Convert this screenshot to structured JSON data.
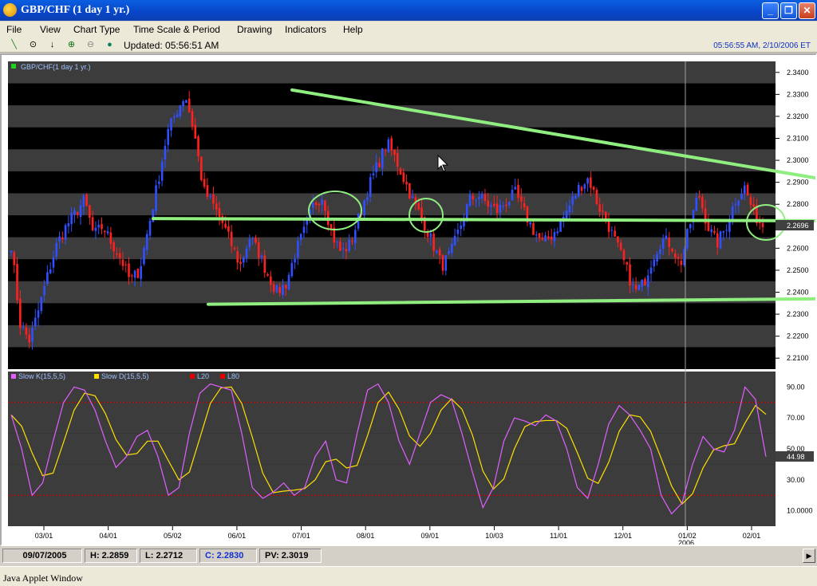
{
  "window": {
    "title": "GBP/CHF (1 day 1 yr.)"
  },
  "menu": [
    "File",
    "View",
    "Chart Type",
    "Time Scale & Period",
    "Drawing",
    "Indicators",
    "Help"
  ],
  "toolbar": {
    "updated": "Updated: 05:56:51 AM",
    "clock": "05:56:55 AM, 2/10/2006 ET"
  },
  "price_panel": {
    "legend": "GBP/CHF(1 day 1 yr.)",
    "legend_color": "#20d020",
    "y_ticks": [
      "2.3400",
      "2.3300",
      "2.3200",
      "2.3100",
      "2.3000",
      "2.2900",
      "2.2800",
      "2.2700",
      "2.2600",
      "2.2500",
      "2.2400",
      "2.2300",
      "2.2200",
      "2.2100"
    ],
    "last_price": "2.2696",
    "up_color": "#3050ff",
    "down_color": "#ff2020",
    "trendline_color": "#90ee80"
  },
  "stoch_panel": {
    "legend": [
      {
        "label": "Slow K(15,5,5)",
        "color": "#e060ff"
      },
      {
        "label": "Slow D(15,5,5)",
        "color": "#ffe000"
      },
      {
        "label": "L20",
        "color": "#e00000"
      },
      {
        "label": "L80",
        "color": "#e00000"
      }
    ],
    "y_ticks": [
      "90.00",
      "70.00",
      "50.00",
      "30.00",
      "10.0000"
    ],
    "last_value": "44.98"
  },
  "x_axis": {
    "labels": [
      "03/01",
      "04/01",
      "05/02",
      "06/01",
      "07/01",
      "08/01",
      "09/01",
      "10/03",
      "11/01",
      "12/01",
      "01/02",
      "02/01"
    ],
    "year_label": "2006"
  },
  "status": {
    "date": "09/07/2005",
    "high": "H: 2.2859",
    "low": "L: 2.2712",
    "close": "C: 2.2830",
    "pv": "PV: 2.3019"
  },
  "footer": "Java Applet Window",
  "chart_data": {
    "type": "candlestick",
    "title": "GBP/CHF (1 day 1 yr.)",
    "ylim": [
      2.205,
      2.345
    ],
    "x_labels": [
      "03/01",
      "04/01",
      "05/02",
      "06/01",
      "07/01",
      "08/01",
      "09/01",
      "10/03",
      "11/01",
      "12/01",
      "01/02",
      "02/01"
    ],
    "close_anchors": [
      2.262,
      2.225,
      2.218,
      2.232,
      2.248,
      2.262,
      2.27,
      2.276,
      2.282,
      2.266,
      2.27,
      2.262,
      2.255,
      2.245,
      2.25,
      2.27,
      2.29,
      2.312,
      2.322,
      2.33,
      2.312,
      2.286,
      2.28,
      2.272,
      2.262,
      2.252,
      2.265,
      2.258,
      2.248,
      2.24,
      2.244,
      2.258,
      2.268,
      2.28,
      2.284,
      2.266,
      2.258,
      2.262,
      2.275,
      2.288,
      2.298,
      2.308,
      2.3,
      2.29,
      2.28,
      2.272,
      2.262,
      2.252,
      2.258,
      2.27,
      2.282,
      2.284,
      2.28,
      2.277,
      2.281,
      2.285,
      2.276,
      2.268,
      2.262,
      2.266,
      2.272,
      2.28,
      2.288,
      2.292,
      2.28,
      2.272,
      2.262,
      2.252,
      2.24,
      2.244,
      2.256,
      2.264,
      2.262,
      2.252,
      2.27,
      2.285,
      2.27,
      2.262,
      2.27,
      2.282,
      2.288,
      2.276,
      2.27
    ],
    "last_close": 2.2696,
    "trendlines_price": [
      {
        "from": [
          "06/23",
          2.332
        ],
        "to": [
          "02/10",
          2.292
        ]
      },
      {
        "from": [
          "04/15",
          2.2735
        ],
        "to": [
          "02/10",
          2.2725
        ]
      },
      {
        "from": [
          "05/16",
          2.2345
        ],
        "to": [
          "02/10",
          2.237
        ]
      }
    ],
    "stochastic": {
      "slow_k_anchors": [
        72,
        50,
        20,
        28,
        55,
        80,
        90,
        88,
        75,
        55,
        38,
        45,
        58,
        62,
        45,
        20,
        25,
        60,
        86,
        92,
        90,
        88,
        60,
        25,
        18,
        22,
        28,
        20,
        25,
        45,
        55,
        30,
        28,
        60,
        88,
        92,
        80,
        55,
        40,
        60,
        80,
        85,
        82,
        60,
        35,
        12,
        25,
        55,
        70,
        68,
        65,
        72,
        68,
        50,
        25,
        18,
        40,
        66,
        78,
        72,
        62,
        50,
        20,
        8,
        15,
        40,
        58,
        50,
        48,
        62,
        90,
        82,
        44.98
      ],
      "levels": [
        20,
        80
      ],
      "ylim": [
        0,
        100
      ]
    }
  }
}
